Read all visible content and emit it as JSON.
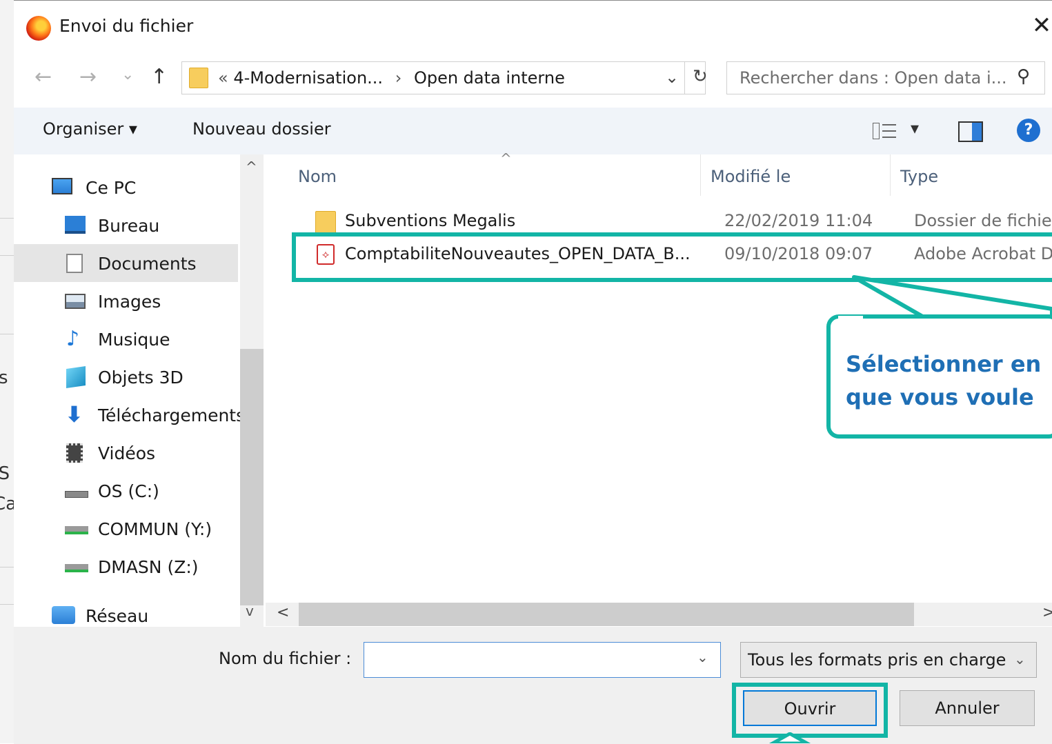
{
  "background": {
    "fragments": [
      "s",
      "JS",
      "Ca"
    ]
  },
  "titlebar": {
    "title": "Envoi du fichier",
    "close_glyph": "✕",
    "app_icon": "firefox-icon"
  },
  "navigation": {
    "back_glyph": "←",
    "forward_glyph": "→",
    "recent_glyph": "⌄",
    "up_glyph": "↑",
    "address_prefix": "«",
    "address_crumb1": "4-Modernisation...",
    "address_sep": "›",
    "address_crumb2": "Open data interne",
    "address_dropdown_glyph": "⌄",
    "refresh_glyph": "↻",
    "search_placeholder": "Rechercher dans : Open data i...",
    "search_glyph": "⚲"
  },
  "toolbar": {
    "organise_label": "Organiser ▾",
    "new_folder_label": "Nouveau dossier",
    "view_glyph": "▾",
    "help_glyph": "?"
  },
  "sidebar": {
    "items": [
      {
        "label": "Ce PC",
        "icon": "computer-icon"
      },
      {
        "label": "Bureau",
        "icon": "desktop-icon"
      },
      {
        "label": "Documents",
        "icon": "documents-icon",
        "selected": true
      },
      {
        "label": "Images",
        "icon": "pictures-icon"
      },
      {
        "label": "Musique",
        "icon": "music-icon"
      },
      {
        "label": "Objets 3D",
        "icon": "objects-3d-icon"
      },
      {
        "label": "Téléchargements",
        "icon": "downloads-icon"
      },
      {
        "label": "Vidéos",
        "icon": "videos-icon"
      },
      {
        "label": "OS (C:)",
        "icon": "drive-c-icon"
      },
      {
        "label": "COMMUN (Y:)",
        "icon": "network-drive-icon"
      },
      {
        "label": "DMASN (Z:)",
        "icon": "network-drive-icon"
      },
      {
        "label": "Réseau",
        "icon": "network-icon"
      }
    ],
    "scroll_up_glyph": "^",
    "scroll_down_glyph": "v"
  },
  "filelist": {
    "sort_glyph": "^",
    "columns": {
      "name": "Nom",
      "modified": "Modifié le",
      "type": "Type"
    },
    "rows": [
      {
        "name": "Subventions Megalis",
        "modified": "22/02/2019 11:04",
        "type": "Dossier de fichiers",
        "icon": "folder-icon"
      },
      {
        "name": "ComptabiliteNouveautes_OPEN_DATA_B...",
        "modified": "09/10/2018 09:07",
        "type": "Adobe Acrobat D...",
        "icon": "pdf-icon"
      }
    ],
    "hscroll_left_glyph": "<",
    "hscroll_right_glyph": ">"
  },
  "bottom": {
    "filename_label": "Nom du fichier :",
    "filename_value": "",
    "filename_dropdown_glyph": "⌄",
    "filter_label": "Tous les formats pris en charge",
    "filter_dropdown_glyph": "⌄",
    "open_label": "Ouvrir",
    "cancel_label": "Annuler"
  },
  "annotation": {
    "line1": "Sélectionner en",
    "line2": "que vous voule",
    "color": "#13b5a6",
    "text_color": "#1f6fb5"
  }
}
